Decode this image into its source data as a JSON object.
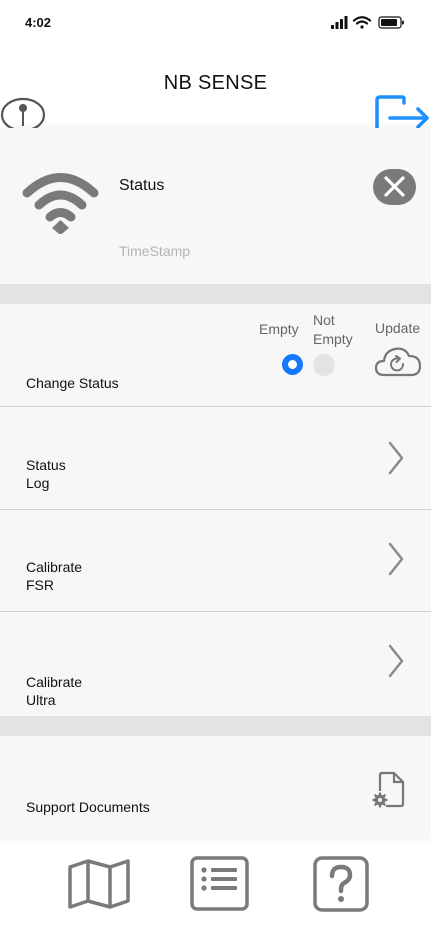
{
  "status_bar": {
    "time": "4:02"
  },
  "app": {
    "title": "NB SENSE"
  },
  "status_card": {
    "title": "Status",
    "timestamp": "TimeStamp"
  },
  "change_status": {
    "label": "Change Status",
    "options": {
      "empty": "Empty",
      "not_empty_line1": "Not",
      "not_empty_line2": "Empty",
      "update": "Update"
    },
    "selected": "Empty"
  },
  "menu": {
    "status_log": {
      "line1": "Status",
      "line2": "Log"
    },
    "calibrate_fsr": {
      "line1": "Calibrate",
      "line2": "FSR"
    },
    "calibrate_ultra": {
      "line1": "Calibrate",
      "line2": "Ultra"
    },
    "support_documents": {
      "label": "Support Documents"
    }
  },
  "bottom_nav": {
    "items": [
      "map-icon",
      "list-icon",
      "help-icon"
    ]
  },
  "colors": {
    "accent": "#1677ff",
    "icon_gray": "#7a7a7a",
    "panel": "#f7f7f7",
    "band": "#e3e3e3"
  }
}
